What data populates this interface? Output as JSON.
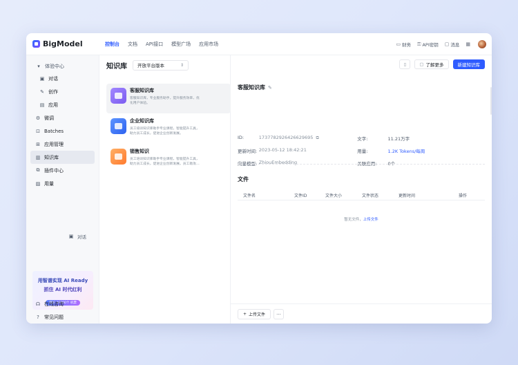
{
  "app": {
    "name": "BigModel"
  },
  "nav": [
    {
      "label": "控制台",
      "active": true
    },
    {
      "label": "文档",
      "active": false
    },
    {
      "label": "API接口",
      "active": false
    },
    {
      "label": "模型广场",
      "active": false
    },
    {
      "label": "应用市场",
      "active": false
    }
  ],
  "topright": {
    "finance": "财务",
    "apikey": "API密钥",
    "messages": "消息"
  },
  "sidebar": {
    "group_label": "体验中心",
    "items": [
      {
        "label": "对话",
        "icon": "chat-icon",
        "sub": true
      },
      {
        "label": "创作",
        "icon": "pen-icon",
        "sub": true
      },
      {
        "label": "应用",
        "icon": "app-icon",
        "sub": true
      },
      {
        "label": "微调",
        "icon": "tune-icon",
        "sub": false
      },
      {
        "label": "Batches",
        "icon": "batch-icon",
        "sub": false
      },
      {
        "label": "应用管理",
        "icon": "manage-icon",
        "sub": false
      },
      {
        "label": "知识库",
        "icon": "book-icon",
        "sub": false,
        "active": true
      },
      {
        "label": "插件中心",
        "icon": "plugin-icon",
        "sub": false
      },
      {
        "label": "用量",
        "icon": "usage-icon",
        "sub": false
      }
    ],
    "chat_shortcut": "对话",
    "banner": {
      "line1": "用智谱实现 AI Ready",
      "line2": "抓住 AI 时代红利",
      "badge": "赠好 10000个 机票"
    },
    "bottom": [
      {
        "label": "在线咨询",
        "icon": "headset-icon"
      },
      {
        "label": "常见问题",
        "icon": "question-icon"
      }
    ]
  },
  "kb": {
    "title": "知识库",
    "select": "开放平台版本",
    "cards": [
      {
        "name": "客服知识库",
        "desc1": "客服知识库，专业服务助手，提升服务效率，优",
        "desc2": "化用户体验。",
        "color": "#8b6cf6"
      },
      {
        "name": "企业知识库",
        "desc1": "员工培训知识库助手专业课程，智能提升工具，",
        "desc2": "助力员工成长，促进企业创新发展。",
        "color": "#3d7bff"
      },
      {
        "name": "销售知识",
        "desc1": "员工培训知识库助手专业课程，智能提升工具，",
        "desc2": "助力员工成长，促进企业创新发展。员工助攻…",
        "color": "#ff8a3d"
      }
    ]
  },
  "detail": {
    "toolbar_more": "了解更多",
    "toolbar_new": "新建知识库",
    "title": "客服知识库",
    "meta": [
      {
        "k1": "ID:",
        "v1": "1737782926426629695",
        "k2": "文字:",
        "v2": "11.21万字",
        "v2style": "dark"
      },
      {
        "k1": "更新时间:",
        "v1": "2023-05-12 18:42:21",
        "k2": "用量:",
        "v2": "1.2K Tokens/每周",
        "v2style": "blue"
      },
      {
        "k1": "向量模型:",
        "v1": "ZhiouEmbedding",
        "k2": "关联应用:",
        "v2": "0个",
        "v2style": "dark"
      }
    ],
    "files_title": "文件",
    "file_columns": [
      "文件名",
      "文件ID",
      "文件大小",
      "文件状态",
      "更新时间",
      "操作"
    ],
    "empty_text": "暂无文件，",
    "empty_link": "上传文件",
    "upload_button": "上传文件",
    "more_button": "···"
  }
}
